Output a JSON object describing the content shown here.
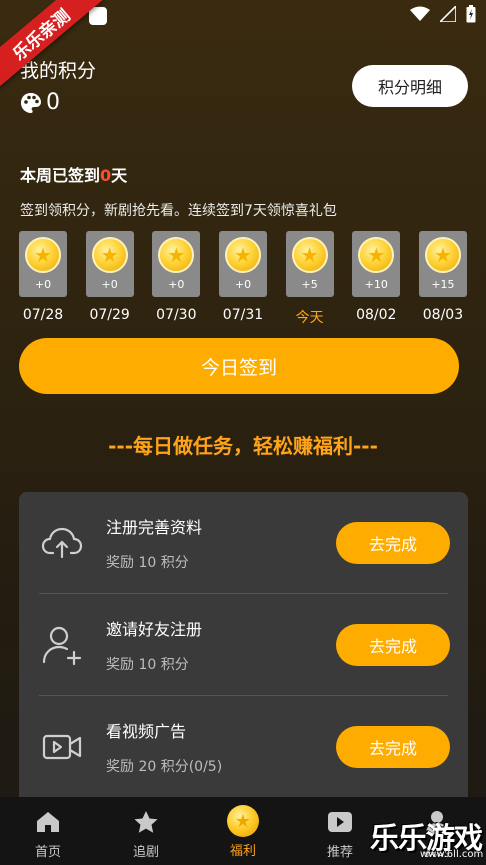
{
  "watermark": {
    "ribbon_text": "乐乐亲测",
    "logo_text": "乐乐游戏",
    "logo_sub": "www.6ll.com"
  },
  "points": {
    "title": "我的积分",
    "value": "0",
    "detail_button": "积分明细"
  },
  "checkin": {
    "week_prefix": "本周已签到",
    "week_count": "0",
    "week_suffix": "天",
    "subtitle": "签到领积分，新剧抢先看。连续签到7天领惊喜礼包",
    "days": [
      {
        "reward": "+0",
        "label": "07/28"
      },
      {
        "reward": "+0",
        "label": "07/29"
      },
      {
        "reward": "+0",
        "label": "07/30"
      },
      {
        "reward": "+0",
        "label": "07/31"
      },
      {
        "reward": "+5",
        "label": "今天"
      },
      {
        "reward": "+10",
        "label": "08/02"
      },
      {
        "reward": "+15",
        "label": "08/03"
      }
    ],
    "sign_button": "今日签到"
  },
  "daily": {
    "title": "---每日做任务，轻松赚福利---",
    "tasks": [
      {
        "name": "注册完善资料",
        "reward": "奖励 10 积分",
        "button": "去完成",
        "icon": "cloud-upload-icon"
      },
      {
        "name": "邀请好友注册",
        "reward": "奖励 10 积分",
        "button": "去完成",
        "icon": "add-user-icon"
      },
      {
        "name": "看视频广告",
        "reward": "奖励 20 积分(0/5)",
        "button": "去完成",
        "icon": "video-icon"
      }
    ]
  },
  "tabs": [
    {
      "label": "首页",
      "icon": "home-icon"
    },
    {
      "label": "追剧",
      "icon": "star-icon"
    },
    {
      "label": "福利",
      "icon": "coin-icon",
      "active": true
    },
    {
      "label": "推荐",
      "icon": "play-icon"
    },
    {
      "label": "我的",
      "icon": "user-icon"
    }
  ],
  "colors": {
    "accent": "#ffac00",
    "accent_text": "#ffa31a",
    "week_count": "#ff4d2e"
  }
}
